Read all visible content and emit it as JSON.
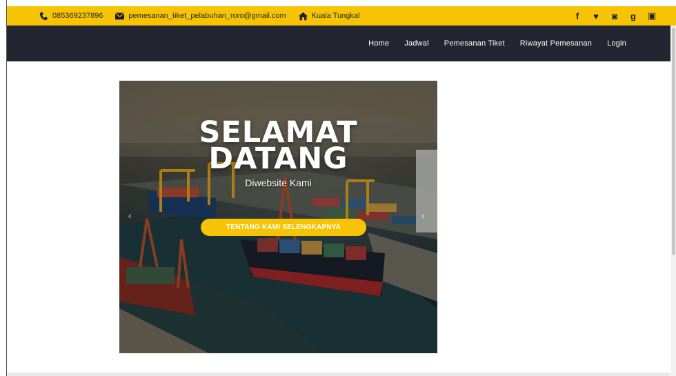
{
  "topbar": {
    "phone": "085369237896",
    "email": "pemesanan_tiket_pelabuhan_roro@gmail.com",
    "location": "Kuala Tungkal",
    "social": [
      "facebook-icon",
      "twitter-icon",
      "instagram-icon",
      "google-plus-icon",
      "youtube-icon"
    ],
    "social_glyphs": [
      "f",
      "♥",
      "◙",
      "g",
      "▣"
    ],
    "background": "#f6c404"
  },
  "navbar": {
    "background": "#232631",
    "items": [
      {
        "label": "Home"
      },
      {
        "label": "Jadwal"
      },
      {
        "label": "Pemesanan Tiket"
      },
      {
        "label": "Riwayat Pemesanan"
      },
      {
        "label": "Login"
      }
    ]
  },
  "hero": {
    "title_line1": "SELAMAT",
    "title_line2": "DATANG",
    "subtitle": "Diwebsite Kami",
    "cta_label": "TENTANG KAMI SELENGKAPNYA",
    "cta_color": "#f6c404",
    "prev_glyph": "‹",
    "next_glyph": "›"
  }
}
